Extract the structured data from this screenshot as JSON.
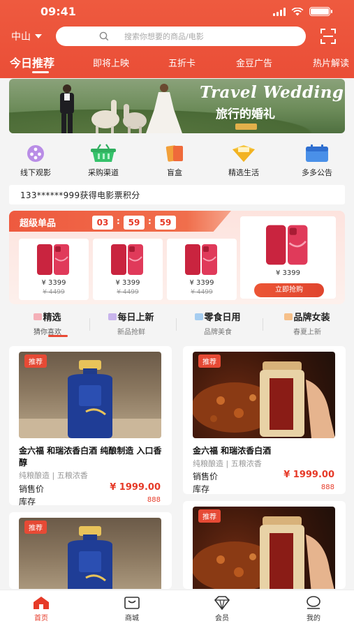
{
  "status_bar": {
    "time": "09:41"
  },
  "header": {
    "city": "中山",
    "search_placeholder": "搜索你想要的商品/电影",
    "tabs": [
      "今日推荐",
      "即将上映",
      "五折卡",
      "金豆广告",
      "热片解读"
    ]
  },
  "banner": {
    "title": "Travel Wedding",
    "subtitle": "旅行的婚礼"
  },
  "quick_icons": [
    {
      "label": "线下观影",
      "icon": "film-reel-icon"
    },
    {
      "label": "采购渠道",
      "icon": "basket-icon"
    },
    {
      "label": "盲盒",
      "icon": "mystery-box-icon"
    },
    {
      "label": "精选生活",
      "icon": "selected-life-icon"
    },
    {
      "label": "多多公告",
      "icon": "calendar-icon"
    }
  ],
  "notice": {
    "text": "133******999获得电影票积分"
  },
  "super_deals": {
    "title": "超级单品",
    "countdown": [
      "03",
      "59",
      "59"
    ],
    "items": [
      {
        "price": "¥ 3399",
        "old_price": "¥ 4499"
      },
      {
        "price": "¥ 3399",
        "old_price": "¥ 4499"
      },
      {
        "price": "¥ 3399",
        "old_price": "¥ 4499"
      }
    ],
    "featured": {
      "price": "¥ 3399",
      "button": "立即抢购"
    },
    "colors": {
      "accent": "#ea4e37",
      "phone": "#d8284a"
    }
  },
  "categories": [
    {
      "title": "精选",
      "sub": "猜你喜欢"
    },
    {
      "title": "每日上新",
      "sub": "新品抢鲜"
    },
    {
      "title": "零食日用",
      "sub": "品牌美食"
    },
    {
      "title": "品牌女装",
      "sub": "春夏上新"
    }
  ],
  "products": [
    {
      "badge": "推荐",
      "title": "金六福 和瑞浓香白酒 纯酿制造 入口香醇",
      "tags": "纯粮酿造 | 五粮浓香",
      "price_label": "销售价",
      "price": "¥ 1999.00",
      "stock_label": "库存",
      "stock": "888",
      "image": "baijiu-bottle"
    },
    {
      "badge": "推荐",
      "title": "金六福 和瑞浓香白酒",
      "tags": "纯粮酿造 | 五粮浓香",
      "price_label": "销售价",
      "price": "¥ 1999.00",
      "stock_label": "库存",
      "stock": "888",
      "image": "liquor-with-dish"
    },
    {
      "badge": "推荐",
      "image": "baijiu-bottle"
    },
    {
      "badge": "推荐",
      "image": "liquor-with-dish"
    }
  ],
  "tabbar": [
    {
      "label": "首页",
      "icon": "home-icon"
    },
    {
      "label": "商城",
      "icon": "store-icon"
    },
    {
      "label": "会员",
      "icon": "diamond-icon"
    },
    {
      "label": "我的",
      "icon": "profile-icon"
    }
  ],
  "colors": {
    "brand": "#ea4e37",
    "price": "#e63a28"
  }
}
